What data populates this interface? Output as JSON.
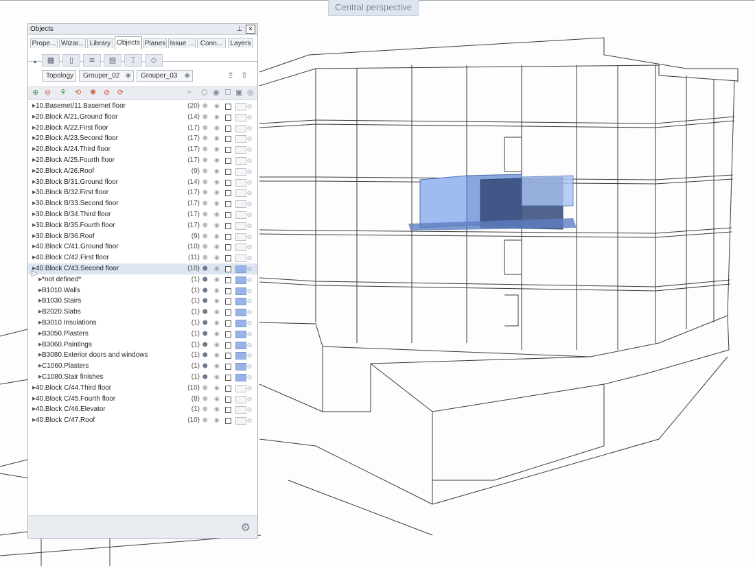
{
  "viewport": {
    "title": "Central perspective"
  },
  "panel": {
    "title": "Objects",
    "pin_icon": "pin-icon",
    "close_icon": "close-icon",
    "tabs": [
      {
        "label": "Prope..."
      },
      {
        "label": "Wizar..."
      },
      {
        "label": "Library"
      },
      {
        "label": "Objects"
      },
      {
        "label": "Planes"
      },
      {
        "label": "Issue ..."
      },
      {
        "label": "Conn..."
      },
      {
        "label": "Layers"
      }
    ],
    "active_tab": "Objects",
    "groupers": [
      {
        "label": "Topology"
      },
      {
        "label": "Grouper_02"
      },
      {
        "label": "Grouper_03"
      }
    ],
    "rows": [
      {
        "label": "10.Basemet/11.Basemet floor",
        "count": "(20)",
        "level": 0,
        "expanded": false,
        "selected": false,
        "color_on": false
      },
      {
        "label": "20.Block A/21.Ground floor",
        "count": "(14)",
        "level": 0
      },
      {
        "label": "20.Block A/22.First floor",
        "count": "(17)",
        "level": 0
      },
      {
        "label": "20.Block A/23.Second floor",
        "count": "(17)",
        "level": 0
      },
      {
        "label": "20.Block A/24.Third floor",
        "count": "(17)",
        "level": 0
      },
      {
        "label": "20.Block A/25.Fourth floor",
        "count": "(17)",
        "level": 0
      },
      {
        "label": "20.Block A/26.Roof",
        "count": "(9)",
        "level": 0
      },
      {
        "label": "30.Block B/31.Ground floor",
        "count": "(14)",
        "level": 0
      },
      {
        "label": "30.Block B/32.First floor",
        "count": "(17)",
        "level": 0
      },
      {
        "label": "30.Block B/33.Second floor",
        "count": "(17)",
        "level": 0
      },
      {
        "label": "30.Block B/34.Third floor",
        "count": "(17)",
        "level": 0
      },
      {
        "label": "30.Block B/35.Fourth floor",
        "count": "(17)",
        "level": 0
      },
      {
        "label": "30.Block B/36.Roof",
        "count": "(9)",
        "level": 0
      },
      {
        "label": "40.Block C/41.Ground floor",
        "count": "(10)",
        "level": 0
      },
      {
        "label": "40.Block C/42.First floor",
        "count": "(11)",
        "level": 0
      },
      {
        "label": "40.Block C/43.Second floor",
        "count": "(10)",
        "level": 0,
        "expanded": true,
        "selected": true,
        "color_on": true
      },
      {
        "label": "*not defined*",
        "count": "(1)",
        "level": 1,
        "color_on": true
      },
      {
        "label": "B1010.Walls",
        "count": "(1)",
        "level": 1,
        "color_on": true
      },
      {
        "label": "B1030.Stairs",
        "count": "(1)",
        "level": 1,
        "color_on": true
      },
      {
        "label": "B2020.Slabs",
        "count": "(1)",
        "level": 1,
        "color_on": true
      },
      {
        "label": "B3010.Insulations",
        "count": "(1)",
        "level": 1,
        "color_on": true
      },
      {
        "label": "B3050.Plasters",
        "count": "(1)",
        "level": 1,
        "color_on": true
      },
      {
        "label": "B3060.Paintings",
        "count": "(1)",
        "level": 1,
        "color_on": true
      },
      {
        "label": "B3080.Exterior doors and windows",
        "count": "(1)",
        "level": 1,
        "color_on": true
      },
      {
        "label": "C1060.Plasters",
        "count": "(1)",
        "level": 1,
        "color_on": true
      },
      {
        "label": "C1080.Stair finishes",
        "count": "(1)",
        "level": 1,
        "color_on": true
      },
      {
        "label": "40.Block C/44.Third floor",
        "count": "(10)",
        "level": 0
      },
      {
        "label": "40.Block C/45.Fourth floor",
        "count": "(8)",
        "level": 0
      },
      {
        "label": "40.Block C/46.Elevator",
        "count": "(1)",
        "level": 0
      },
      {
        "label": "40.Block C/47.Roof",
        "count": "(10)",
        "level": 0
      }
    ]
  },
  "colors": {
    "highlight_blue": "#98b3e8",
    "selection_row": "#dce5f1",
    "view_tab": "#dfe5ee"
  }
}
